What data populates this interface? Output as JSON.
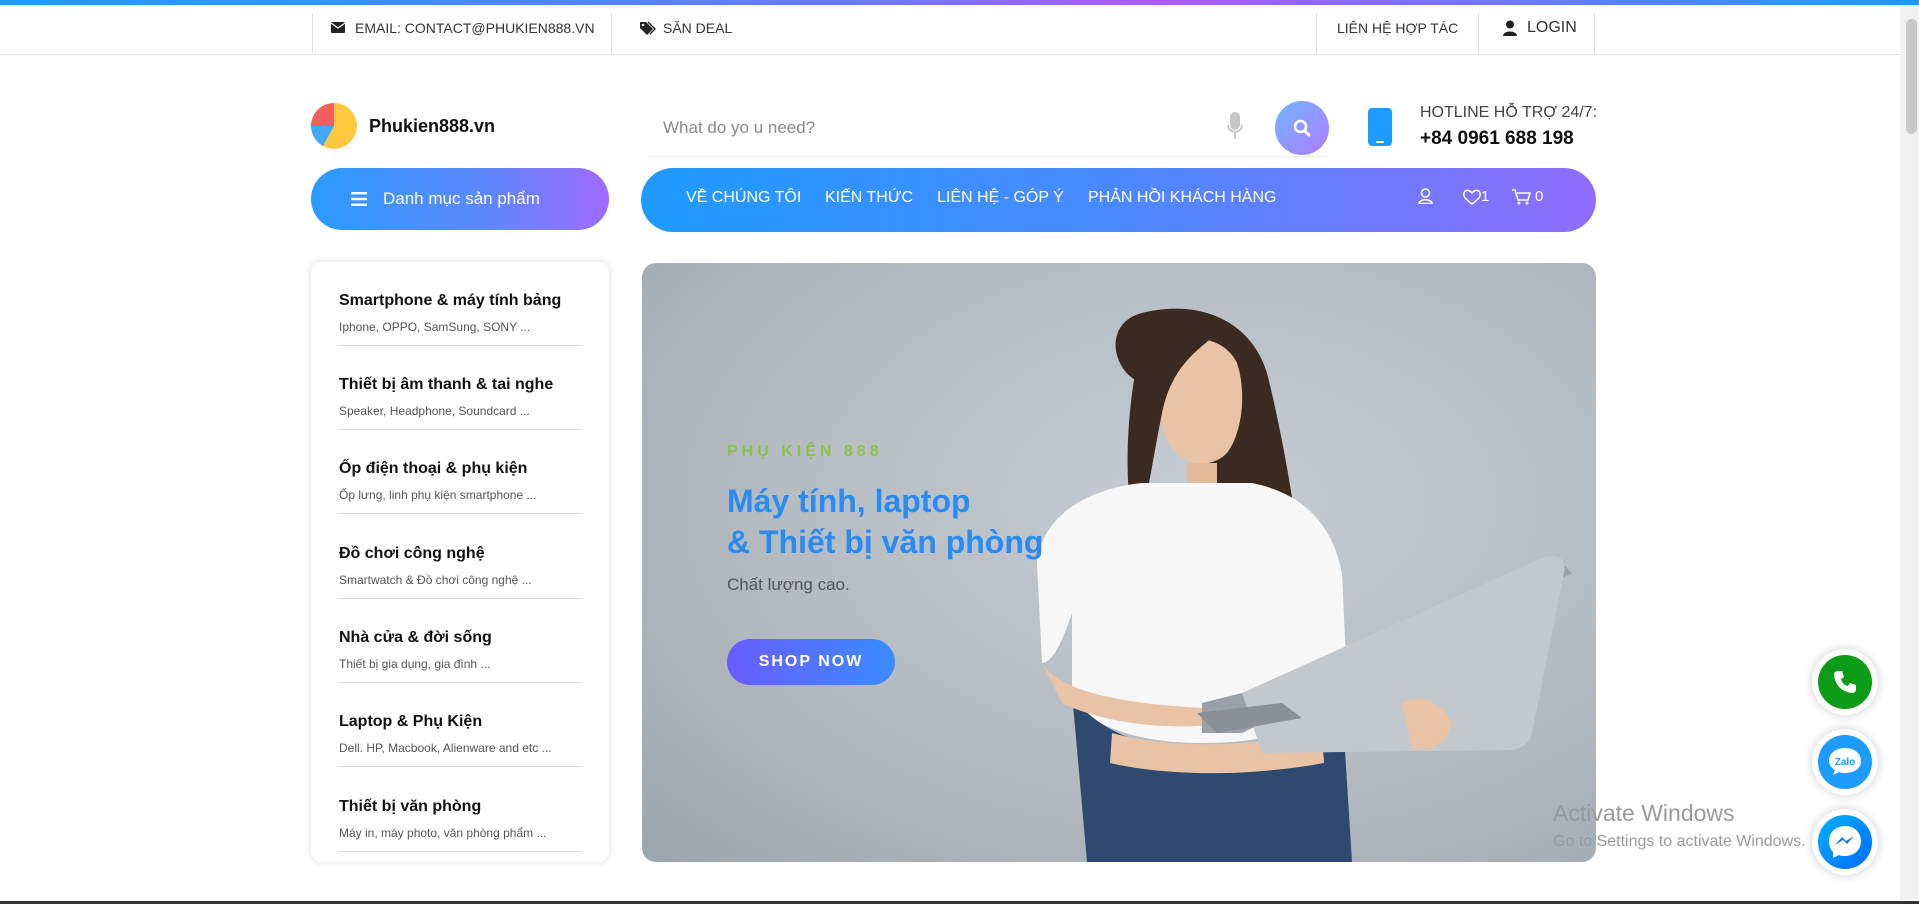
{
  "topbar": {
    "email": "EMAIL: CONTACT@PHUKIEN888.VN",
    "deal": "SĂN DEAL",
    "partner": "LIÊN HỆ HỢP TÁC",
    "login": "LOGIN"
  },
  "header": {
    "logo_text": "Phukien888.vn",
    "search_placeholder": "What do yo u need?",
    "hotline_label": "HOTLINE HỖ TRỢ 24/7:",
    "hotline_number": "+84 0961 688 198"
  },
  "nav": {
    "category_button": "Danh mục sản phẩm",
    "items": [
      {
        "label": "VỀ CHÚNG TÔI"
      },
      {
        "label": "KIẾN THỨC"
      },
      {
        "label": "LIÊN HỆ - GÓP Ý"
      },
      {
        "label": "PHẢN HỒI KHÁCH HÀNG"
      }
    ],
    "wishlist_count": "1",
    "cart_count": "0"
  },
  "sidebar": {
    "categories": [
      {
        "title": "Smartphone & máy tính bảng",
        "sub": "Iphone, OPPO, SamSung, SONY ..."
      },
      {
        "title": "Thiết bị âm thanh & tai nghe",
        "sub": "Speaker, Headphone, Soundcard ..."
      },
      {
        "title": "Ốp điện thoại & phụ kiện",
        "sub": "Ốp lưng, linh phụ kiện smartphone ..."
      },
      {
        "title": "Đồ chơi công nghệ",
        "sub": "Smartwatch & Đồ chơi công nghệ ..."
      },
      {
        "title": "Nhà cửa & đời sống",
        "sub": "Thiết bị gia dụng, gia đình ..."
      },
      {
        "title": "Laptop & Phụ Kiện",
        "sub": "Dell. HP, Macbook, Alienware and etc ..."
      },
      {
        "title": "Thiết bị văn phòng",
        "sub": "Máy in, máy photo, văn phòng phẩm ..."
      }
    ]
  },
  "hero": {
    "kicker": "PHỤ KIỆN 888",
    "title_line1": "Máy tính, laptop",
    "title_line2": "& Thiết bị văn phòng",
    "subtitle": "Chất lượng cao.",
    "cta": "SHOP NOW"
  },
  "floating": {
    "zalo_label": "Zalo"
  },
  "windows_watermark": {
    "title": "Activate Windows",
    "sub": "Go to Settings to activate Windows."
  },
  "colors": {
    "brand_blue": "#1e9bff",
    "brand_purple": "#8e6dff",
    "kicker_green": "#8bc34a",
    "hero_title": "#2a8cf3",
    "call_green": "#0d9c17"
  }
}
